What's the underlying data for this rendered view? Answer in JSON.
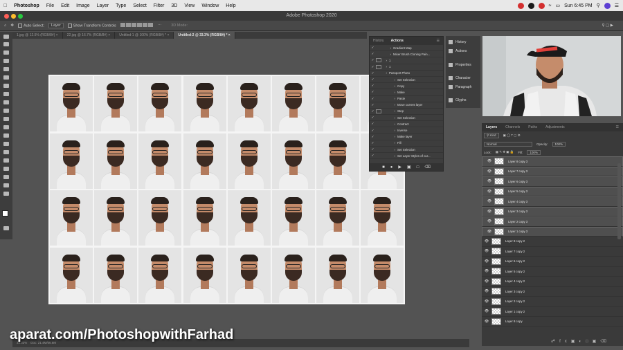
{
  "macbar": {
    "app": "Photoshop",
    "menus": [
      "File",
      "Edit",
      "Image",
      "Layer",
      "Type",
      "Select",
      "Filter",
      "3D",
      "View",
      "Window",
      "Help"
    ],
    "clock": "Sun 6:45 PM",
    "status_colors": [
      "#d32f2f",
      "#1a1a1a",
      "#d32f2f"
    ]
  },
  "title": "Adobe Photoshop 2020",
  "options": {
    "auto_select": "Auto-Select:",
    "auto_select_target": "Layer",
    "show_transform": "Show Transform Controls",
    "mode_3d": "3D Mode:"
  },
  "tabs": [
    {
      "label": "1.jpg @ 12.5% (RGB/8#)"
    },
    {
      "label": "22.jpg @ 16.7% (RGB/8#)"
    },
    {
      "label": "Untitled-1 @ 100% (RGB/8#) *"
    },
    {
      "label": "Untitled-2 @ 33.3% (RGB/8#) *",
      "active": true
    }
  ],
  "actions_panel": {
    "tabs": [
      "History",
      "Actions"
    ],
    "active_tab": "Actions",
    "rows": [
      "Gradient Map",
      "Mixer Brush Cloning Pain...",
      "1",
      "1",
      "Passport Photo",
      "Set Selection",
      "Copy",
      "Make",
      "Paste",
      "Move current layer",
      "Step",
      "Set Selection",
      "Contract",
      "Inverse",
      "Make layer",
      "Fill",
      "Set Selection",
      "Set Layer Styles of cur..."
    ]
  },
  "mini_panel": [
    "History",
    "Actions",
    "Properties",
    "Character",
    "Paragraph",
    "Glyphs"
  ],
  "layers_panel": {
    "tabs": [
      "Layers",
      "Channels",
      "Paths",
      "Adjustments"
    ],
    "active_tab": "Layers",
    "kind": "Kind",
    "blend": "Normal",
    "opacity_label": "Opacity:",
    "opacity": "100%",
    "lock_label": "Lock:",
    "fill_label": "Fill:",
    "fill": "100%",
    "layers": [
      {
        "name": "Layer 8 copy 3",
        "selected": true
      },
      {
        "name": "Layer 7 copy 3",
        "selected": true
      },
      {
        "name": "Layer 6 copy 3",
        "selected": true
      },
      {
        "name": "Layer 5 copy 3",
        "selected": true
      },
      {
        "name": "Layer 4 copy 3",
        "selected": true
      },
      {
        "name": "Layer 3 copy 3",
        "selected": true
      },
      {
        "name": "Layer 2 copy 3",
        "selected": true
      },
      {
        "name": "Layer 1 copy 3",
        "selected": true
      },
      {
        "name": "Layer 8 copy 2",
        "selected": false
      },
      {
        "name": "Layer 7 copy 2",
        "selected": false
      },
      {
        "name": "Layer 6 copy 2",
        "selected": false
      },
      {
        "name": "Layer 5 copy 2",
        "selected": false
      },
      {
        "name": "Layer 4 copy 2",
        "selected": false
      },
      {
        "name": "Layer 3 copy 2",
        "selected": false
      },
      {
        "name": "Layer 2 copy 2",
        "selected": false
      },
      {
        "name": "Layer 1 copy 2",
        "selected": false
      },
      {
        "name": "Layer 8 copy",
        "selected": false
      }
    ]
  },
  "status": {
    "zoom": "33.33%",
    "doc": "Doc: 21.4M/66.6M"
  },
  "watermark": "aparat.com/PhotoshopwithFarhad",
  "canvas": {
    "rows": 4,
    "cols": 8
  }
}
